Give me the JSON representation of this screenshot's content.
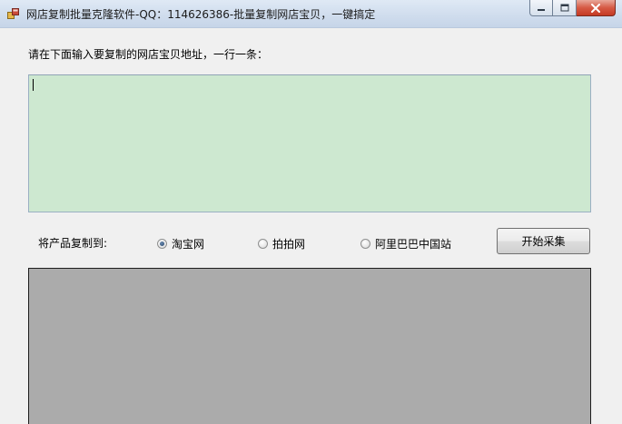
{
  "window": {
    "title": "网店复制批量克隆软件-QQ：114626386-批量复制网店宝贝，一键搞定"
  },
  "instruction": {
    "text": "请在下面输入要复制的网店宝贝地址，一行一条："
  },
  "url_input": {
    "value": "",
    "placeholder": ""
  },
  "target": {
    "label": "将产品复制到:",
    "options": [
      {
        "label": "淘宝网",
        "checked": true
      },
      {
        "label": "拍拍网",
        "checked": false
      },
      {
        "label": "阿里巴巴中国站",
        "checked": false
      }
    ]
  },
  "actions": {
    "start_label": "开始采集"
  },
  "colors": {
    "input_bg": "#cde8d0",
    "log_bg": "#ababab",
    "window_bg": "#f0f0f0"
  }
}
